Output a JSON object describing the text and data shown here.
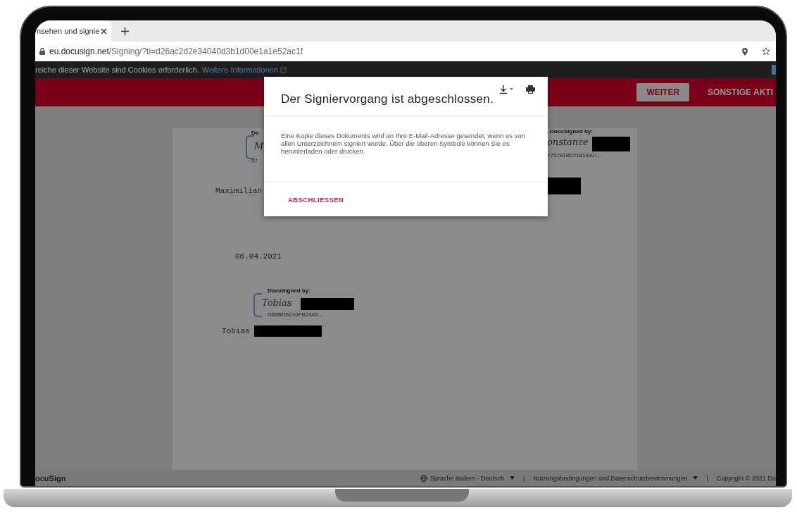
{
  "browser": {
    "tab": {
      "title": "nsehen und signie"
    },
    "address": {
      "host": "eu.docusign.net",
      "path": "/Signing/?ti=d26ac2d2e34040d3b1d00e1a1e52ac1f"
    }
  },
  "cookie_banner": {
    "text": "reiche dieser Website sind Cookies erforderlich.",
    "link": "Weitere Informationen"
  },
  "toolbar": {
    "buttons": [
      {
        "label": "WEITER",
        "kind": "filled"
      },
      {
        "label": "SONSTIGE AKTI",
        "kind": "text"
      }
    ]
  },
  "document": {
    "signature_blocks": [
      {
        "caption": "Do",
        "signature": "M",
        "id": "97"
      },
      {
        "caption": "DocuSigned by:",
        "signature": "onstanze",
        "id": "7757818D71814AC..."
      },
      {
        "caption": "DocuSigned by:",
        "signature": "Tobias",
        "id": "D89BD5210FB2449..."
      }
    ],
    "date": "06.04.2021",
    "names": [
      "Maximilian",
      "Tobias"
    ]
  },
  "dialog": {
    "title": "Der Signiervorgang ist abgeschlossen.",
    "message": "Eine Kopie dieses Dokuments wird an Ihre E-Mail-Adresse gesendet, wenn es von allen Unterzeichnern signiert wurde. Über die oberen Symbole können Sie es herunterladen oder drucken.",
    "action": "ABSCHLIESSEN"
  },
  "footer": {
    "logo": "ocuSign",
    "language": "Sprache ändern - Deutsch",
    "terms": "Nutzungsbedingungen und Datenschutzbestimmungen",
    "copyright": "Copyright © 2021 Do",
    "separators": [
      "|",
      "|"
    ]
  }
}
